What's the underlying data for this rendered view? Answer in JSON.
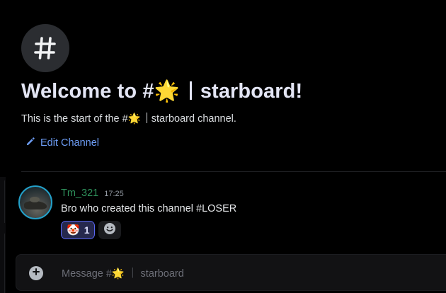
{
  "channel_header": {
    "welcome_prefix": "Welcome to #",
    "emoji": "🌟",
    "welcome_suffix": "starboard!",
    "start_prefix": "This is the start of the #",
    "start_suffix": "starboard channel.",
    "edit_label": "Edit Channel"
  },
  "message": {
    "author": "Tm_321",
    "timestamp": "17:25",
    "text": "Bro who created this channel #LOSER",
    "author_color": "#2e8f5a",
    "reactions": [
      {
        "emoji": "🤡",
        "count": "1"
      }
    ]
  },
  "composer": {
    "placeholder": "Message #🌟 ｜ starboard"
  },
  "colors": {
    "accent": "#5865f2",
    "link": "#6d9df5",
    "background": "#000000"
  },
  "icons": {
    "channel": "hash-icon",
    "edit": "pencil-icon",
    "add_reaction": "smiley-icon",
    "attach": "plus-circle-icon"
  }
}
